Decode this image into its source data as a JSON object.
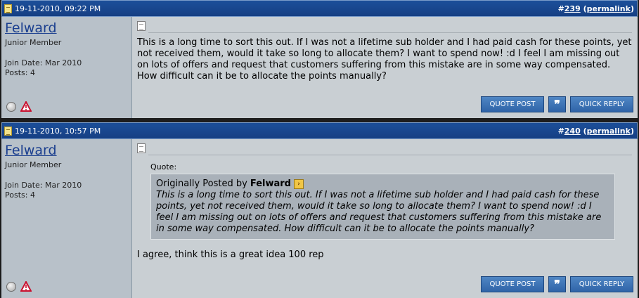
{
  "posts": [
    {
      "date": "19-11-2010, 09:22 PM",
      "number": "239",
      "permalink": "permalink",
      "username": "Felward",
      "usertitle": "Junior Member",
      "join_date": "Join Date: Mar 2010",
      "posts": "Posts: 4",
      "message": "This is a long time to sort this out. If I was not a lifetime sub holder and I had paid cash for these points, yet not received them, would it take so long to allocate them? I want to spend now! :d I feel I am missing out on lots of offers and request that customers suffering from this mistake are in some way compensated. How difficult can it be to allocate the points manually?",
      "buttons": {
        "quote": "QUOTE POST",
        "multi": "❞",
        "reply": "QUICK REPLY"
      }
    },
    {
      "date": "19-11-2010, 10:57 PM",
      "number": "240",
      "permalink": "permalink",
      "username": "Felward",
      "usertitle": "Junior Member",
      "join_date": "Join Date: Mar 2010",
      "posts": "Posts: 4",
      "quote_label": "Quote:",
      "quote_prefix": "Originally Posted by",
      "quote_author": "Felward",
      "quote_text": "This is a long time to sort this out. If I was not a lifetime sub holder and I had paid cash for these points, yet not received them, would it take so long to allocate them? I want to spend now! :d I feel I am missing out on lots of offers and request that customers suffering from this mistake are in some way compensated. How difficult can it be to allocate the points manually?",
      "message": "I agree, think this is a great idea 100 rep",
      "buttons": {
        "quote": "QUOTE POST",
        "multi": "❞",
        "reply": "QUICK REPLY"
      }
    }
  ],
  "icons": {
    "date": "post-date-icon",
    "status": "offline-status-icon",
    "report": "report-post-icon",
    "post": "post-icon",
    "view_post": "view-post-icon"
  }
}
